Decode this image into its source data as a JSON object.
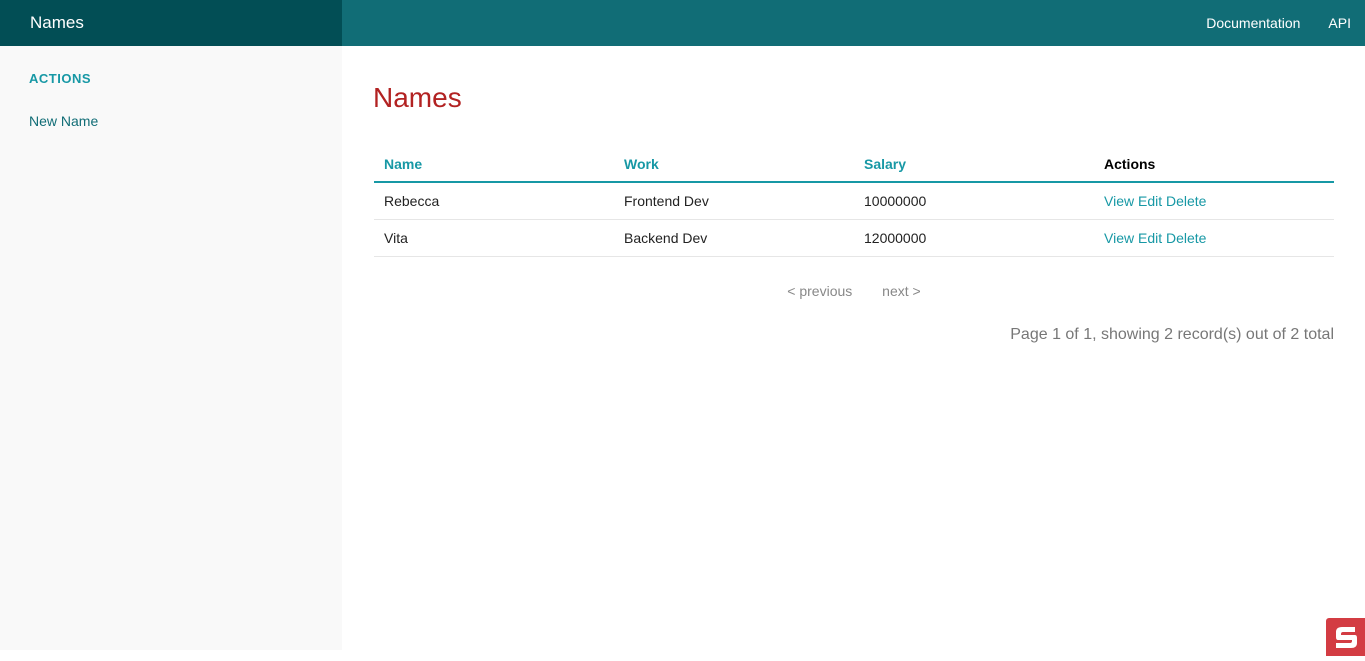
{
  "header": {
    "brand": "Names",
    "nav": [
      "Documentation",
      "API"
    ]
  },
  "sidebar": {
    "heading": "ACTIONS",
    "links": [
      "New Name"
    ]
  },
  "main": {
    "title": "Names",
    "table": {
      "columns": [
        "Name",
        "Work",
        "Salary",
        "Actions"
      ],
      "rows": [
        {
          "name": "Rebecca",
          "work": "Frontend Dev",
          "salary": "10000000"
        },
        {
          "name": "Vita",
          "work": "Backend Dev",
          "salary": "12000000"
        }
      ],
      "row_actions": [
        "View",
        "Edit",
        "Delete"
      ]
    },
    "pager": {
      "previous": "< previous",
      "next": "next >"
    },
    "counter": "Page 1 of 1, showing 2 record(s) out of 2 total"
  },
  "colors": {
    "topbar": "#116d76",
    "brand_bg": "#024e55",
    "accent": "#1798a5",
    "title": "#b22222",
    "badge": "#d33c43"
  },
  "icons": {
    "corner_badge": "debug-kit-icon"
  }
}
